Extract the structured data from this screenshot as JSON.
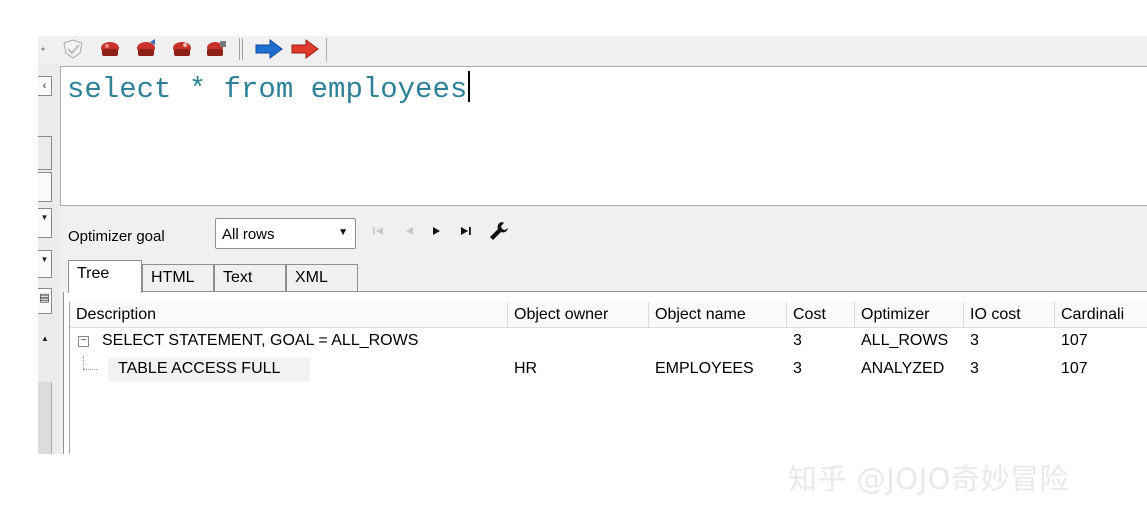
{
  "editor": {
    "sql_text": "select * from employees"
  },
  "optimizer": {
    "label": "Optimizer goal",
    "selected": "All rows",
    "nav_icons": [
      "first-icon",
      "prev-icon",
      "next-icon",
      "last-icon",
      "wrench-icon"
    ]
  },
  "tabs": [
    {
      "label": "Tree",
      "active": true
    },
    {
      "label": "HTML",
      "active": false
    },
    {
      "label": "Text",
      "active": false
    },
    {
      "label": "XML",
      "active": false
    }
  ],
  "plan": {
    "columns": [
      "Description",
      "Object owner",
      "Object name",
      "Cost",
      "Optimizer",
      "IO cost",
      "Cardinali"
    ],
    "rows": [
      {
        "description": "SELECT STATEMENT, GOAL = ALL_ROWS",
        "owner": "",
        "name": "",
        "cost": "3",
        "optimizer": "ALL_ROWS",
        "io_cost": "3",
        "cardinality": "107"
      },
      {
        "description": "TABLE ACCESS FULL",
        "owner": "HR",
        "name": "EMPLOYEES",
        "cost": "3",
        "optimizer": "ANALYZED",
        "io_cost": "3",
        "cardinality": "107"
      }
    ]
  },
  "watermark": "知乎 @JOJO奇妙冒险",
  "colors": {
    "sql_text": "#2e8199",
    "accent_red": "#c8322a",
    "accent_blue": "#1d6fd1"
  }
}
